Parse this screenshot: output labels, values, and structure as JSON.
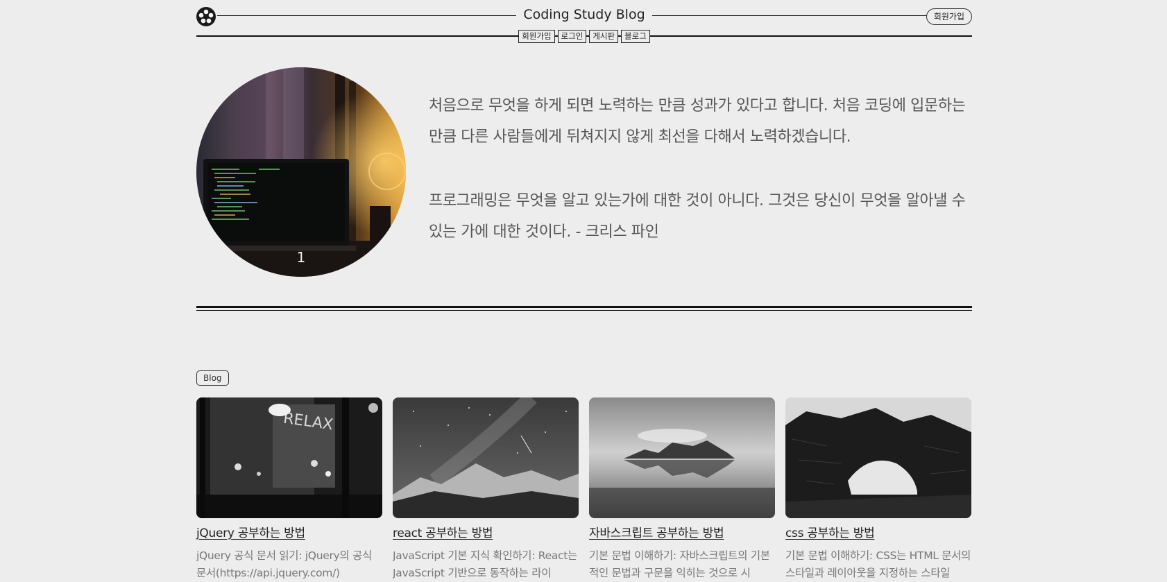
{
  "header": {
    "site_title": "Coding Study Blog",
    "signup_button": "회원가입",
    "logo_icon": "flower-logo-icon"
  },
  "nav": {
    "items": [
      {
        "label": "회원가입"
      },
      {
        "label": "로그인"
      },
      {
        "label": "게시판"
      },
      {
        "label": "블로그"
      }
    ]
  },
  "intro": {
    "slide_number": "1",
    "paragraph_1": "처음으로 무엇을 하게 되면 노력하는 만큼 성과가 있다고 합니다. 처음 코딩에 입문하는 만큼 다른 사람들에게 뒤쳐지지 않게 최선을 다해서 노력하겠습니다.",
    "paragraph_2": "프로그래밍은 무엇을 알고 있는가에 대한 것이 아니다. 그것은 당신이 무엇을 알아낼 수 있는 가에 대한 것이다. - 크리스 파인"
  },
  "blog": {
    "badge": "Blog",
    "cards": [
      {
        "title": "jQuery 공부하는 방법",
        "excerpt": "jQuery 공식 문서 읽기: jQuery의 공식 문서(https://api.jquery.com/)"
      },
      {
        "title": "react 공부하는 방법",
        "excerpt": "JavaScript 기본 지식 확인하기: React는 JavaScript 기반으로 동작하는 라이"
      },
      {
        "title": "자바스크립트 공부하는 방법",
        "excerpt": "기본 문법 이해하기: 자바스크립트의 기본적인 문법과 구문을 익히는 것으로 시"
      },
      {
        "title": "css 공부하는 방법",
        "excerpt": "기본 문법 이해하기: CSS는 HTML 문서의 스타일과 레이아웃을 지정하는 스타일"
      }
    ]
  },
  "colors": {
    "background": "#ededed",
    "text": "#333333",
    "muted_text": "#777777",
    "rule": "#111111"
  }
}
